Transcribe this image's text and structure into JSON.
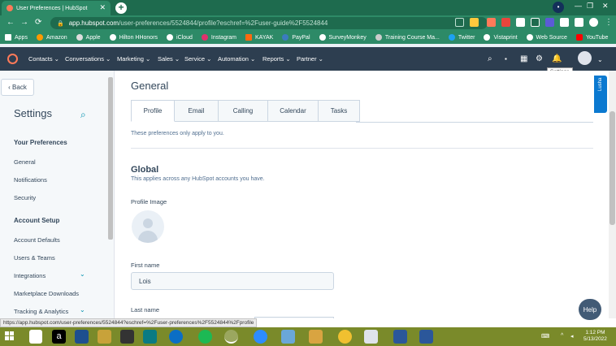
{
  "browser": {
    "tab_title": "User Preferences | HubSpot",
    "tab_close": "✕",
    "new_tab": "+",
    "profile_initial": "•",
    "window_controls": [
      "—",
      "❐",
      "✕"
    ],
    "url_host": "app.hubspot.com",
    "url_path": "/user-preferences/5524844/profile?eschref=%2Fuser-guide%2F5524844",
    "nav": [
      "←",
      "→",
      "⟳"
    ],
    "status_url": "https://app.hubspot.com/user-preferences/5524844?eschref=%2Fuser-preferences%2F5524844%2Fprofile"
  },
  "bookmarks": [
    {
      "label": "Apps",
      "color": "#ffffff"
    },
    {
      "label": "Amazon",
      "color": "#ff9900"
    },
    {
      "label": "Apple",
      "color": "#dddddd"
    },
    {
      "label": "Hilton HHonors",
      "color": "#ffffff"
    },
    {
      "label": "iCloud",
      "color": "#ffffff"
    },
    {
      "label": "Instagram",
      "color": "#e1306c"
    },
    {
      "label": "KAYAK",
      "color": "#ff690f"
    },
    {
      "label": "PayPal",
      "color": "#3b7bbf"
    },
    {
      "label": "SurveyMonkey",
      "color": "#ffffff"
    },
    {
      "label": "Training Course Ma...",
      "color": "#cccccc"
    },
    {
      "label": "Twitter",
      "color": "#1da1f2"
    },
    {
      "label": "Vistaprint",
      "color": "#ffffff"
    },
    {
      "label": "Web Source",
      "color": "#ffffff"
    },
    {
      "label": "YouTube",
      "color": "#ff0000"
    }
  ],
  "hubspot_nav": {
    "items": [
      "Contacts ⌄",
      "Conversations ⌄",
      "Marketing ⌄",
      "Sales ⌄",
      "Service ⌄",
      "Automation ⌄",
      "Reports ⌄",
      "Partner ⌄"
    ],
    "tooltip": "Settings",
    "brand_color": "#ff7a59",
    "bg_color": "#2d3e50"
  },
  "sidebar": {
    "back_label": "‹  Back",
    "title": "Settings",
    "search_icon": "⌕",
    "section_prefs": "Your Preferences",
    "pref_items": [
      "General",
      "Notifications",
      "Security"
    ],
    "section_account": "Account Setup",
    "account_items": [
      "Account Defaults",
      "Users & Teams",
      "Integrations",
      "Marketplace Downloads",
      "Tracking & Analytics"
    ],
    "chevron": "⌄"
  },
  "main": {
    "title": "General",
    "tabs": [
      "Profile",
      "Email",
      "Calling",
      "Calendar",
      "Tasks"
    ],
    "pref_note": "These preferences only apply to you.",
    "global_title": "Global",
    "global_desc": "This applies across any HubSpot accounts you have.",
    "profile_image_label": "Profile Image",
    "first_name_label": "First name",
    "first_name_value": "Lois",
    "last_name_label": "Last name"
  },
  "widgets": {
    "side_tab": "Lusha",
    "help": "Help"
  },
  "taskbar": {
    "time": "1:12 PM",
    "date": "5/13/2022"
  }
}
